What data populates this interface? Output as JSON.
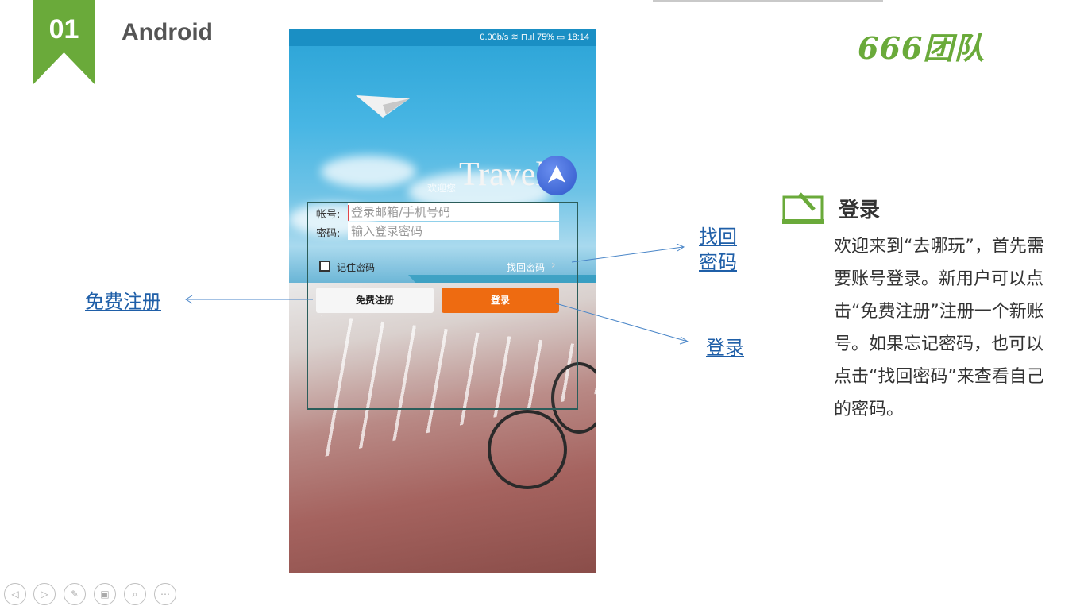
{
  "slide": {
    "number": "01",
    "title": "Android",
    "accent": "#6aaa3a"
  },
  "logo": {
    "text": "666团队"
  },
  "phone": {
    "status_bar": "0.00b/s  ≋  ⊓.ıl 75% ▭ 18:14",
    "brand": "Travel",
    "welcome": "欢迎您",
    "account_label": "帐号:",
    "account_placeholder": "登录邮箱/手机号码",
    "password_label": "密码:",
    "password_placeholder": "输入登录密码",
    "remember_label": "记住密码",
    "forgot_link": "找回密码",
    "register_button": "免费注册",
    "login_button": "登录"
  },
  "annotations": {
    "register": "免费注册",
    "forgot": "找回密码",
    "login": "登录"
  },
  "note": {
    "title": "登录",
    "body": "欢迎来到“去哪玩”，首先需要账号登录。新用户可以点击“免费注册”注册一个新账号。如果忘记密码，也可以点击“找回密码”来查看自己的密码。"
  },
  "toolbar": {
    "icons": [
      "prev-icon",
      "next-icon",
      "pen-icon",
      "slides-icon",
      "zoom-icon",
      "more-icon"
    ]
  }
}
